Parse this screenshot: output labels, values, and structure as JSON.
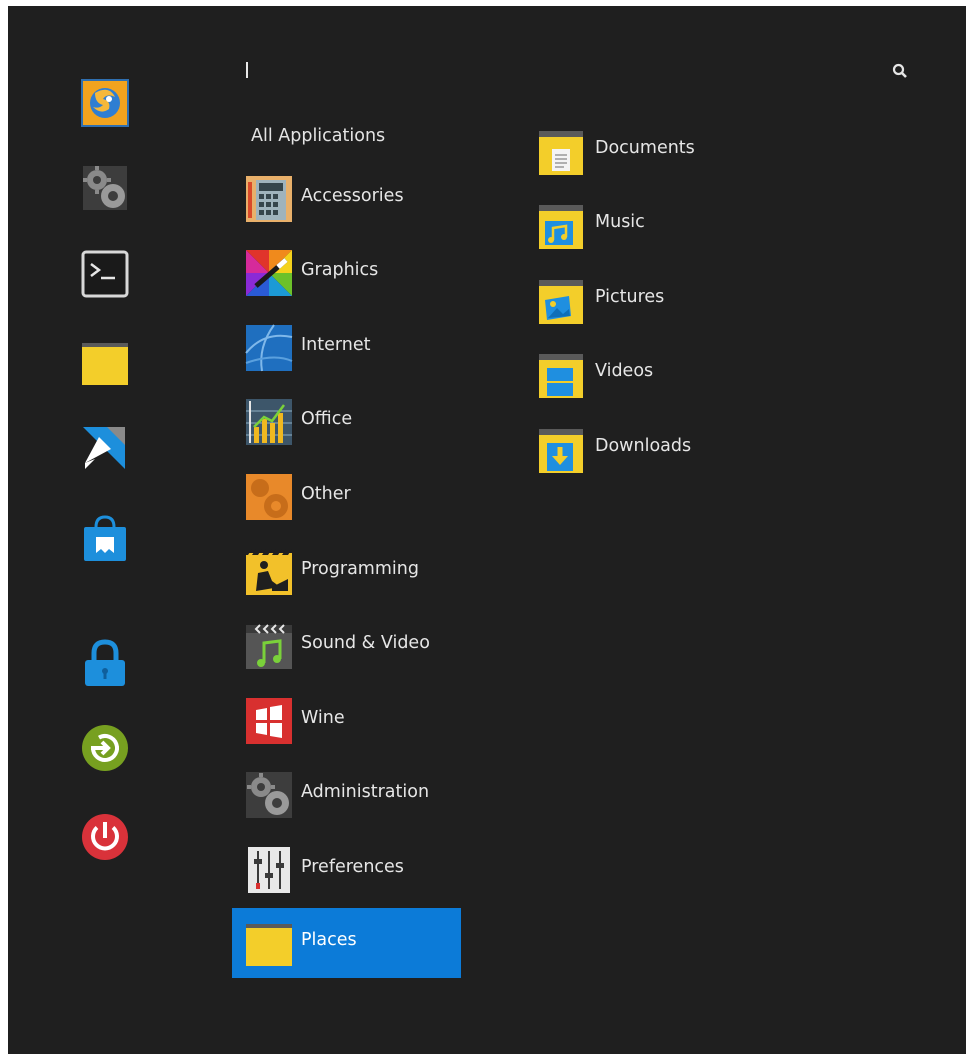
{
  "search": {
    "placeholder": "",
    "value": ""
  },
  "favorites": [
    {
      "icon": "firefox-icon"
    },
    {
      "icon": "settings-gears-icon"
    },
    {
      "icon": "terminal-icon"
    },
    {
      "icon": "folder-icon"
    },
    {
      "icon": "xfce-icon"
    },
    {
      "icon": "software-store-icon"
    }
  ],
  "session": [
    {
      "icon": "lock-screen-icon"
    },
    {
      "icon": "logout-icon"
    },
    {
      "icon": "power-icon"
    }
  ],
  "categories": {
    "header": "All Applications",
    "items": [
      {
        "label": "Accessories",
        "icon": "accessories-icon"
      },
      {
        "label": "Graphics",
        "icon": "graphics-icon"
      },
      {
        "label": "Internet",
        "icon": "internet-icon"
      },
      {
        "label": "Office",
        "icon": "office-icon"
      },
      {
        "label": "Other",
        "icon": "other-icon"
      },
      {
        "label": "Programming",
        "icon": "programming-icon"
      },
      {
        "label": "Sound & Video",
        "icon": "sound-video-icon"
      },
      {
        "label": "Wine",
        "icon": "wine-icon"
      },
      {
        "label": "Administration",
        "icon": "administration-icon"
      },
      {
        "label": "Preferences",
        "icon": "preferences-icon"
      },
      {
        "label": "Places",
        "icon": "places-icon",
        "selected": true
      }
    ]
  },
  "places": [
    {
      "label": "Documents",
      "icon": "documents-folder-icon"
    },
    {
      "label": "Music",
      "icon": "music-folder-icon"
    },
    {
      "label": "Pictures",
      "icon": "pictures-folder-icon"
    },
    {
      "label": "Videos",
      "icon": "videos-folder-icon"
    },
    {
      "label": "Downloads",
      "icon": "downloads-folder-icon"
    }
  ],
  "colors": {
    "background": "#1f1f1f",
    "selection": "#0c7bd8",
    "text": "#e6e6e6",
    "folder_yellow": "#f3ce2a"
  }
}
